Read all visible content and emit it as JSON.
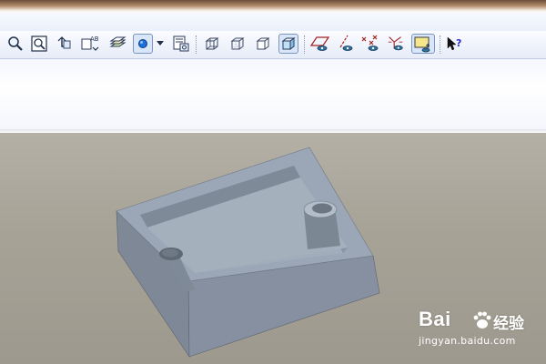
{
  "toolbar": {
    "icons": [
      "zoom-in-icon",
      "zoom-fit-icon",
      "reorient-icon",
      "refit-named-view-icon",
      "layers-icon",
      "display-style-icon",
      "dropdown-arrow-icon",
      "model-tree-icon",
      "wireframe-icon",
      "hidden-line-icon",
      "no-hidden-icon",
      "shading-icon",
      "datum-planes-icon",
      "datum-axes-icon",
      "datum-points-icon",
      "coordinate-systems-icon",
      "spin-center-icon",
      "context-help-icon"
    ],
    "active": [
      "display-style-icon",
      "shading-icon",
      "spin-center-icon"
    ],
    "refit_label": "AB"
  },
  "viewport": {
    "background": "#a8a498",
    "model": "rectangular block with pocket and two holes",
    "model_color": "#8f9aa8"
  },
  "watermark": {
    "brand": "Bai",
    "brand_cn": "经验",
    "url": "jingyan.baidu.com"
  }
}
